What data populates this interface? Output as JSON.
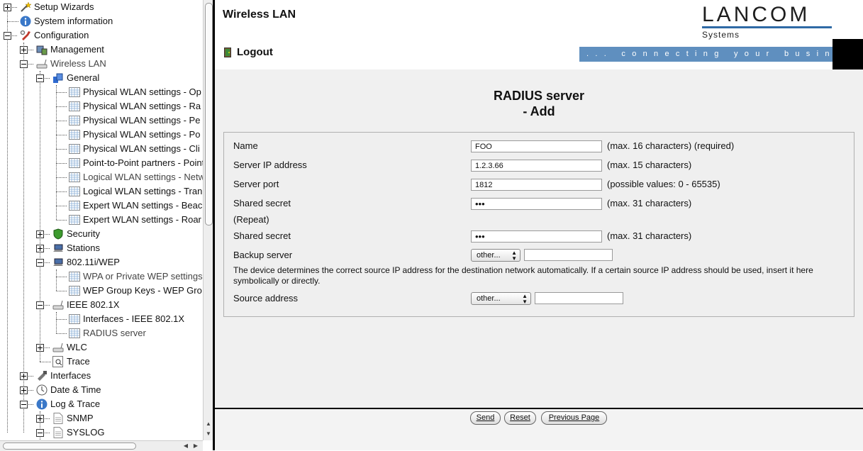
{
  "tree": {
    "items": [
      {
        "label": "Setup Wizards",
        "icon": "wand-icon"
      },
      {
        "label": "System information",
        "icon": "info-icon"
      },
      {
        "label": "Configuration",
        "icon": "configuration-icon"
      },
      {
        "label": "Management",
        "icon": "management-icon"
      },
      {
        "label": "Wireless LAN",
        "icon": "wireless-icon"
      },
      {
        "label": "General",
        "icon": "general-icon"
      },
      {
        "label": "Physical WLAN settings - Op",
        "icon": "table-icon"
      },
      {
        "label": "Physical WLAN settings - Ra",
        "icon": "table-icon"
      },
      {
        "label": "Physical WLAN settings - Pe",
        "icon": "table-icon"
      },
      {
        "label": "Physical WLAN settings - Po",
        "icon": "table-icon"
      },
      {
        "label": "Physical WLAN settings - Cli",
        "icon": "table-icon"
      },
      {
        "label": "Point-to-Point partners - Point",
        "icon": "table-icon"
      },
      {
        "label": "Logical WLAN settings - Netw",
        "icon": "table-icon"
      },
      {
        "label": "Logical WLAN settings - Tran",
        "icon": "table-icon"
      },
      {
        "label": "Expert WLAN settings - Beac",
        "icon": "table-icon"
      },
      {
        "label": "Expert WLAN settings - Roar",
        "icon": "table-icon"
      },
      {
        "label": "Security",
        "icon": "shield-icon"
      },
      {
        "label": "Stations",
        "icon": "stations-icon"
      },
      {
        "label": "802.11i/WEP",
        "icon": "stations-icon"
      },
      {
        "label": "WPA or Private WEP settings",
        "icon": "table-icon"
      },
      {
        "label": "WEP Group Keys - WEP Gro",
        "icon": "table-icon"
      },
      {
        "label": "IEEE 802.1X",
        "icon": "wireless-icon"
      },
      {
        "label": "Interfaces - IEEE 802.1X",
        "icon": "table-icon"
      },
      {
        "label": "RADIUS server",
        "icon": "table-icon"
      },
      {
        "label": "WLC",
        "icon": "wireless-icon"
      },
      {
        "label": "Trace",
        "icon": "trace-icon"
      },
      {
        "label": "Interfaces",
        "icon": "interfaces-icon"
      },
      {
        "label": "Date & Time",
        "icon": "clock-icon"
      },
      {
        "label": "Log & Trace",
        "icon": "info-icon"
      },
      {
        "label": "SNMP",
        "icon": "document-icon"
      },
      {
        "label": "SYSLOG",
        "icon": "document-icon"
      }
    ]
  },
  "header": {
    "title": "Wireless LAN",
    "logo_word": "LANCOM",
    "logo_sub": "Systems",
    "logout": "Logout",
    "slogan": "... connecting your business",
    "brand_color": "#5f8fbf"
  },
  "main": {
    "heading_line1": "RADIUS server",
    "heading_line2": "- Add",
    "fields": {
      "name": {
        "label": "Name",
        "value": "FOO",
        "hint": "(max. 16 characters) (required)"
      },
      "server_ip": {
        "label": "Server IP address",
        "value": "1.2.3.66",
        "hint": "(max. 15 characters)"
      },
      "server_port": {
        "label": "Server port",
        "value": "1812",
        "hint": "(possible values: 0 - 65535)"
      },
      "secret": {
        "label": "Shared secret",
        "value": "•••",
        "hint": "(max. 31 characters)"
      },
      "repeat_label": "(Repeat)",
      "secret_repeat": {
        "label": "Shared secret",
        "value": "•••",
        "hint": "(max. 31 characters)"
      },
      "backup": {
        "label": "Backup server",
        "select": "other...",
        "value": ""
      },
      "info": "The device determines the correct source IP address for the destination network automatically. If a certain source IP address should be used, insert it here symbolically or directly.",
      "source": {
        "label": "Source address",
        "select": "other...",
        "value": ""
      }
    }
  },
  "footer": {
    "send": "Send",
    "reset": "Reset",
    "previous": "Previous Page"
  }
}
